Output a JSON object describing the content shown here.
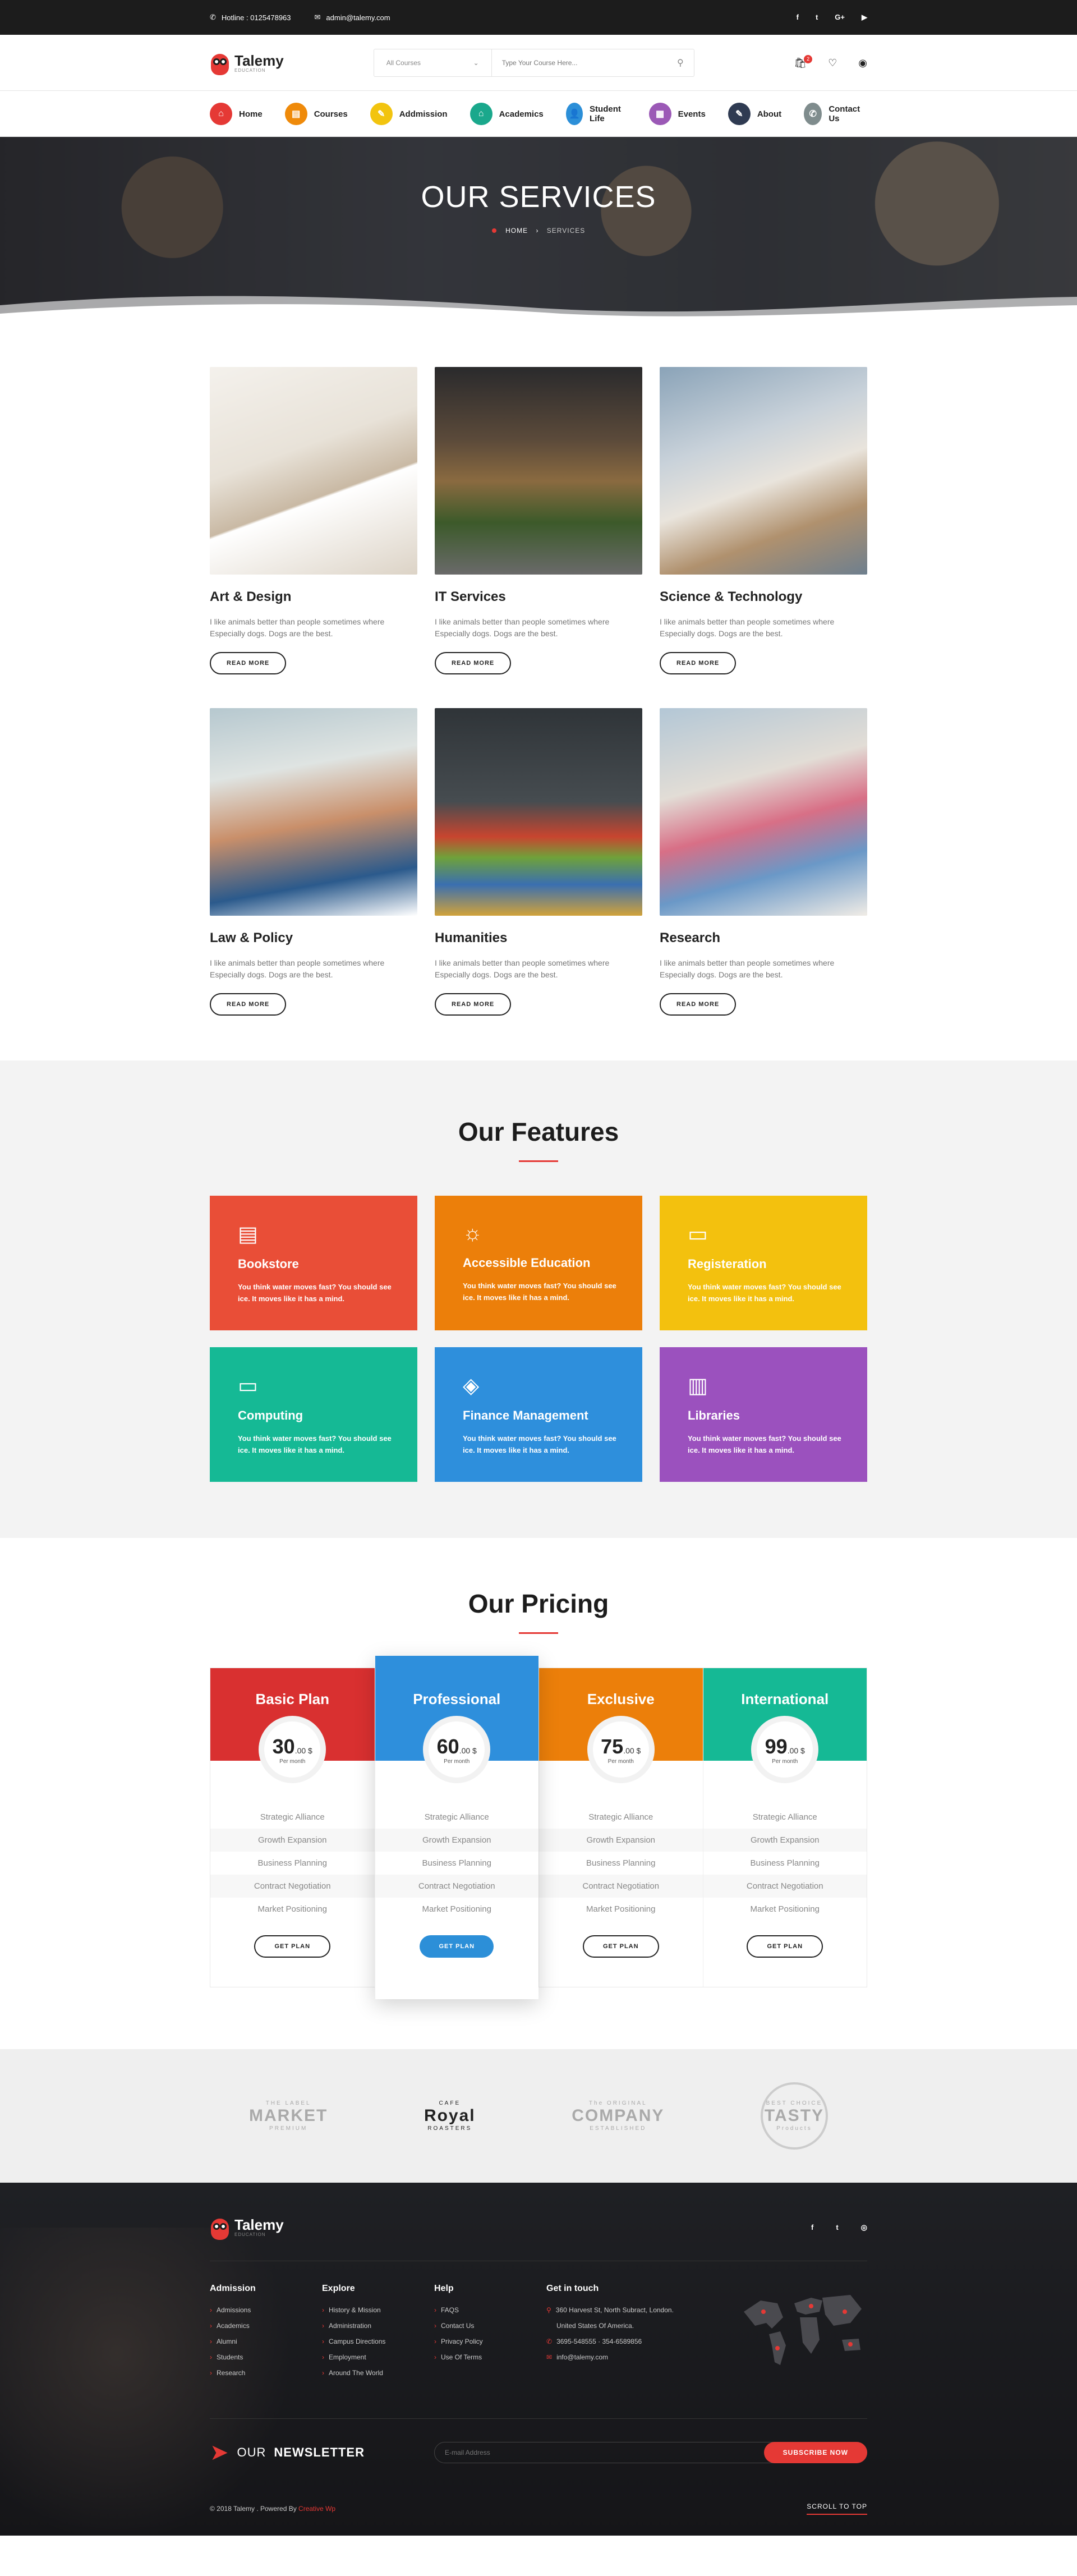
{
  "topbar": {
    "hotline_label": "Hotline : 0125478963",
    "email": "admin@talemy.com",
    "socials": [
      "f",
      "t",
      "G+",
      "▶"
    ]
  },
  "header": {
    "logo_name": "Talemy",
    "logo_tag": "EDUCATION",
    "category_value": "All Courses",
    "search_placeholder": "Type Your Course Here...",
    "cart_count": "2"
  },
  "nav": [
    {
      "label": "Home",
      "color": "#e53935",
      "icon": "⌂"
    },
    {
      "label": "Courses",
      "color": "#ef8a0a",
      "icon": "▤"
    },
    {
      "label": "Addmission",
      "color": "#f2c40f",
      "icon": "✎"
    },
    {
      "label": "Academics",
      "color": "#1aa88c",
      "icon": "⌂"
    },
    {
      "label": "Student Life",
      "color": "#2c8fd8",
      "icon": "👤"
    },
    {
      "label": "Events",
      "color": "#9b59b6",
      "icon": "▦"
    },
    {
      "label": "About",
      "color": "#2f3b52",
      "icon": "✎"
    },
    {
      "label": "Contact Us",
      "color": "#7f8c8d",
      "icon": "✆"
    }
  ],
  "hero": {
    "title": "OUR SERVICES",
    "crumb_home": "HOME",
    "crumb_current": "SERVICES"
  },
  "services": {
    "read_more": "READ MORE",
    "items": [
      {
        "title": "Art & Design",
        "text": "I like animals better than people sometimes where Especially dogs. Dogs are the best."
      },
      {
        "title": "IT Services",
        "text": "I like animals better than people sometimes where Especially dogs. Dogs are the best."
      },
      {
        "title": "Science & Technology",
        "text": "I like animals better than people sometimes where Especially dogs. Dogs are the best."
      },
      {
        "title": "Law & Policy",
        "text": "I like animals better than people sometimes where Especially dogs. Dogs are the best."
      },
      {
        "title": "Humanities",
        "text": "I like animals better than people sometimes where Especially dogs. Dogs are the best."
      },
      {
        "title": "Research",
        "text": "I like animals better than people sometimes where Especially dogs. Dogs are the best."
      }
    ]
  },
  "features": {
    "title": "Our Features",
    "items": [
      {
        "title": "Bookstore",
        "text": "You think water moves fast? You should see ice. It moves like it has a mind.",
        "color": "#e94e37",
        "icon": "▤"
      },
      {
        "title": "Accessible  Education",
        "text": "You think water moves fast? You should see ice. It moves like it has a mind.",
        "color": "#ec7f0a",
        "icon": "☼"
      },
      {
        "title": "Registeration",
        "text": "You think water moves fast? You should see ice. It moves like it has a mind.",
        "color": "#f3c10e",
        "icon": "▭"
      },
      {
        "title": "Computing",
        "text": "You think water moves fast? You should see ice. It moves like it has a mind.",
        "color": "#15b995",
        "icon": "▭"
      },
      {
        "title": "Finance Management",
        "text": "You think water moves fast? You should see ice. It moves like it has a mind.",
        "color": "#2e8fdc",
        "icon": "◈"
      },
      {
        "title": "Libraries",
        "text": "You think water moves fast? You should see ice. It moves like it has a mind.",
        "color": "#9b51be",
        "icon": "▥"
      }
    ]
  },
  "pricing": {
    "title": "Our Pricing",
    "features": [
      "Strategic Alliance",
      "Growth Expansion",
      "Business Planning",
      "Contract Negotiation",
      "Market Positioning"
    ],
    "button": "GET PLAN",
    "per": "Per month",
    "plans": [
      {
        "name": "Basic Plan",
        "price": "30",
        "decimal": ".00 $",
        "color": "#d93030"
      },
      {
        "name": "Professional",
        "price": "60",
        "decimal": ".00 $",
        "color": "#2e8fdc"
      },
      {
        "name": "Exclusive",
        "price": "75",
        "decimal": ".00 $",
        "color": "#ec7f0a"
      },
      {
        "name": "International",
        "price": "99",
        "decimal": ".00 $",
        "color": "#15b995"
      }
    ]
  },
  "brands": [
    {
      "top": "THE LABEL",
      "main": "MARKET",
      "bottom": "PREMIUM"
    },
    {
      "top": "CAFE",
      "main": "Royal",
      "bottom": "ROASTERS"
    },
    {
      "top": "The ORIGINAL",
      "main": "COMPANY",
      "bottom": "ESTABLISHED"
    },
    {
      "top": "BEST CHOICE",
      "main": "TASTY",
      "bottom": "Products"
    }
  ],
  "footer": {
    "logo_name": "Talemy",
    "logo_tag": "EDUCATION",
    "socials": [
      "f",
      "t",
      "◎"
    ],
    "col1": {
      "title": "Admission",
      "items": [
        "Admissions",
        "Academics",
        "Alumni",
        "Students",
        "Research"
      ]
    },
    "col2": {
      "title": "Explore",
      "items": [
        "History & Mission",
        "Administration",
        "Campus Directions",
        "Employment",
        "Around The World"
      ]
    },
    "col3": {
      "title": "Help",
      "items": [
        "FAQS",
        "Contact Us",
        "Privacy Policy",
        "Use Of Terms"
      ]
    },
    "contact": {
      "title": "Get in touch",
      "address1": "360 Harvest St, North Subract, London.",
      "address2": "United States Of America.",
      "phone": "3695-548555  ·  354-6589856",
      "email": "info@talemy.com"
    },
    "newsletter_label": "OUR",
    "newsletter_bold": "NEWSLETTER",
    "email_placeholder": "E-mail Address",
    "subscribe": "SUBSCRIBE NOW",
    "copyright": "© 2018 Talemy . Powered By",
    "powered": "Creative Wp",
    "scroll_top": "SCROLL TO TOP"
  }
}
